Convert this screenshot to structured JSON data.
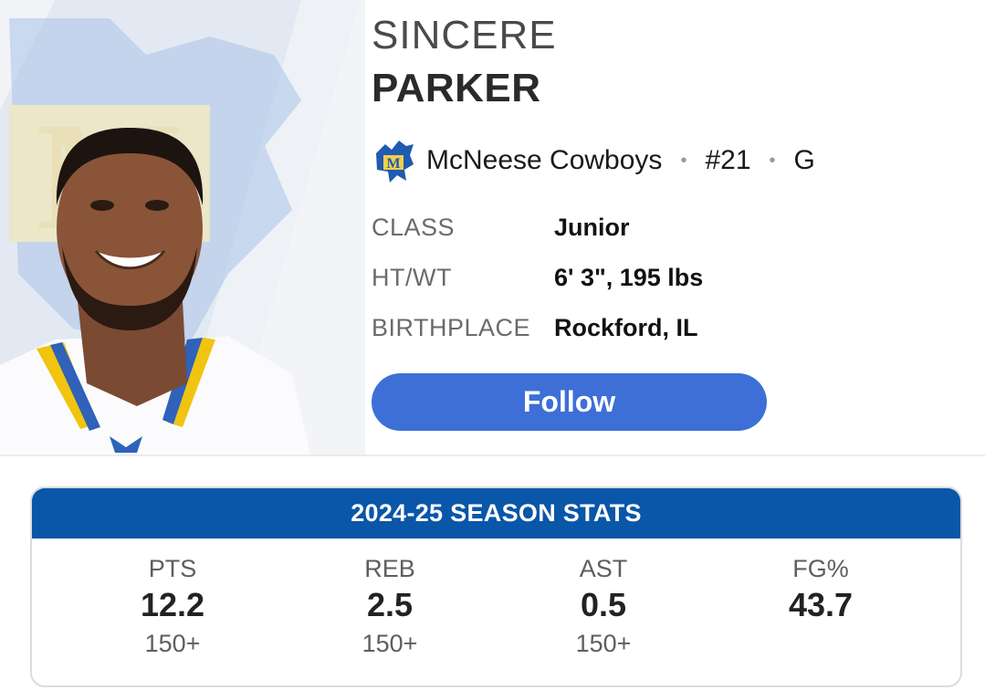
{
  "player": {
    "first_name": "SINCERE",
    "last_name": "PARKER",
    "team": "McNeese Cowboys",
    "number": "#21",
    "position": "G",
    "separator": "•",
    "team_logo_icon": "cowboy-horse-logo-icon",
    "photo": "player-headshot"
  },
  "info": [
    {
      "label": "CLASS",
      "value": "Junior"
    },
    {
      "label": "HT/WT",
      "value": "6' 3\", 195 lbs"
    },
    {
      "label": "BIRTHPLACE",
      "value": "Rockford, IL"
    }
  ],
  "follow_label": "Follow",
  "stats": {
    "title": "2024-25 SEASON STATS",
    "items": [
      {
        "label": "PTS",
        "value": "12.2",
        "rank": "150+"
      },
      {
        "label": "REB",
        "value": "2.5",
        "rank": "150+"
      },
      {
        "label": "AST",
        "value": "0.5",
        "rank": "150+"
      },
      {
        "label": "FG%",
        "value": "43.7",
        "rank": ""
      }
    ]
  },
  "colors": {
    "follow_button": "#3d6fd6",
    "stats_header": "#0a56a8",
    "team_gold": "#f2cf4a",
    "team_blue": "#1f5bb0"
  }
}
